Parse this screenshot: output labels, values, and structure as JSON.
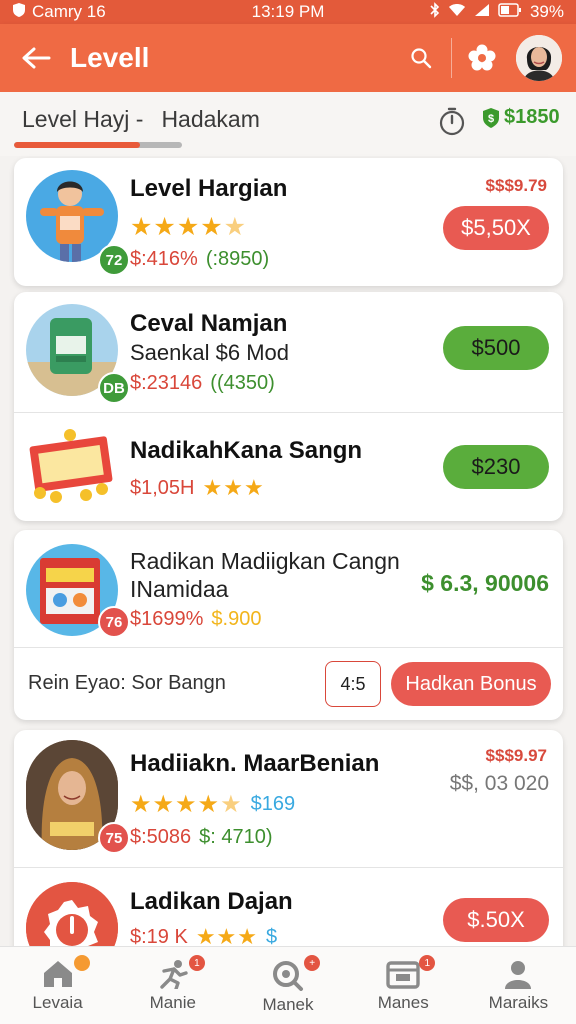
{
  "status_bar": {
    "carrier": "Camry 16",
    "time": "13:19 PM",
    "battery": "39%"
  },
  "app_bar": {
    "title": "Levell"
  },
  "sub_header": {
    "title_a": "Level Hayj -",
    "title_b": "Hadakam",
    "balance": "$1850",
    "progress_percent": 75
  },
  "cards": {
    "card1": {
      "title": "Level Hargian",
      "badge": "72",
      "meta_price": "$:416%",
      "meta_extra": "(:8950)",
      "old_price": "$$$9.79",
      "action": "$5,50X"
    },
    "card2": {
      "row1": {
        "title": "Ceval Namjan",
        "subtitle": "Saenkal $6 Mod",
        "badge": "DB",
        "meta_price": "$:23146",
        "meta_extra": "((4350)",
        "action": "$500"
      },
      "row2": {
        "title": "NadikahKana Sangn",
        "meta_price": "$1,05H",
        "action": "$230"
      }
    },
    "card3": {
      "title": "Radikan Madiigkan Cangn",
      "subtitle": "INamidaa",
      "badge": "76",
      "meta_price": "$1699%",
      "meta_extra": "$.900",
      "amount": "$ 6.3, 90006",
      "footer_text": "Rein Eyao: Sor Bangn",
      "ratio": "4:5",
      "bonus": "Hadkan Bonus"
    },
    "card4": {
      "row1": {
        "title": "Hadiiakn. MaarBenian",
        "badge": "75",
        "rating_extra": "$169",
        "meta_price": "$:5086",
        "meta_extra": "$: 4710)",
        "old_price": "$$$9.97",
        "amount": "$$, 03 020"
      },
      "row2": {
        "title": "Ladikan Dajan",
        "meta_price": "$:19 K",
        "action": "$.50X"
      }
    }
  },
  "bottom_nav": [
    {
      "label": "Levaia",
      "icon": "home-icon"
    },
    {
      "label": "Manie",
      "icon": "runner-icon"
    },
    {
      "label": "Manek",
      "icon": "search-icon"
    },
    {
      "label": "Manes",
      "icon": "wallet-icon"
    },
    {
      "label": "Maraiks",
      "icon": "person-icon"
    }
  ],
  "colors": {
    "primary": "#ef6a44",
    "accent_green": "#5aad3c",
    "accent_red": "#e85a52"
  }
}
